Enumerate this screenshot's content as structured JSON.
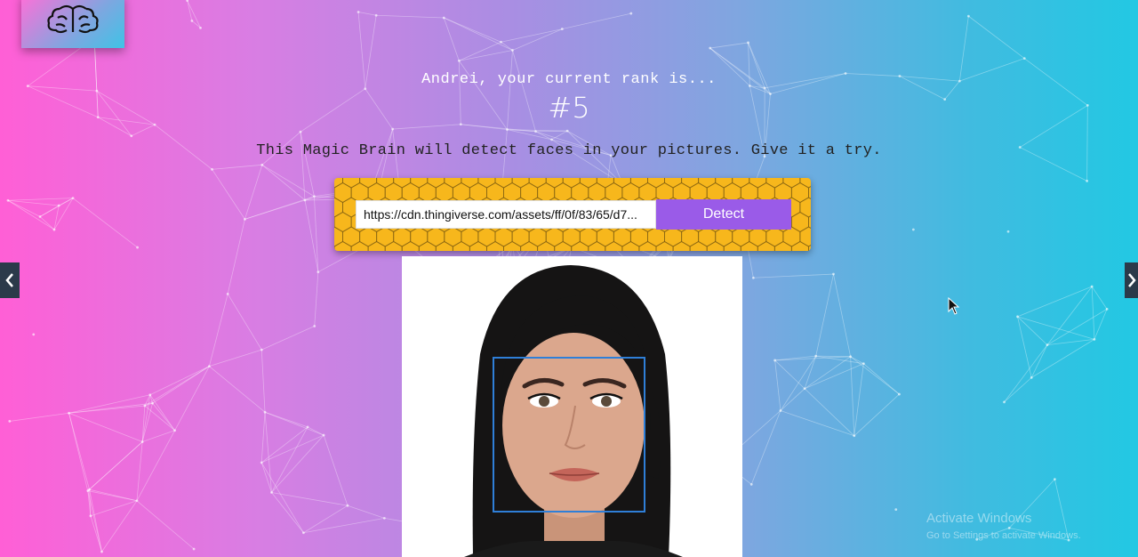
{
  "header": {
    "rank_line": "Andrei, your current rank is...",
    "rank_value": "#5",
    "tagline": "This Magic Brain will detect faces in your pictures. Give it a try."
  },
  "form": {
    "url_value": "https://cdn.thingiverse.com/assets/ff/0f/83/65/d7...",
    "detect_label": "Detect"
  },
  "watermark": {
    "line1": "Activate Windows",
    "line2": "Go to Settings to activate Windows."
  },
  "icons": {
    "logo": "brain-icon",
    "prev": "chevron-left-icon",
    "next": "chevron-right-icon",
    "pointer": "mouse-cursor-icon"
  },
  "colors": {
    "detect_button": "#9a5be8",
    "form_background": "#f7b71c",
    "face_box": "#2f7fd8"
  }
}
